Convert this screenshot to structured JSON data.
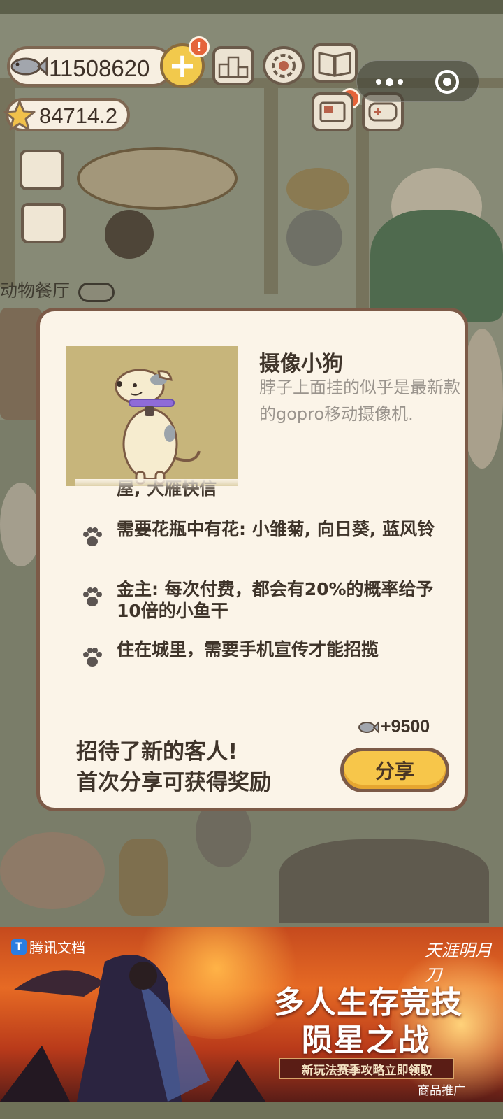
{
  "hud": {
    "fish_count": "11508620",
    "star_count": "84714.2",
    "plus_alert": "!",
    "book_alert": "!"
  },
  "scene": {
    "restaurant_label": "动物餐厅"
  },
  "dialog": {
    "guest_name": "摄像小狗",
    "guest_description": "脖子上面挂的似乎是最新款的gopro移动摄像机.",
    "requirements": [
      {
        "text": "屋, 大雁快信",
        "icon": "paw-icon"
      },
      {
        "text": "需要花瓶中有花: 小雏菊, 向日葵, 蓝风铃",
        "icon": "paw-icon"
      },
      {
        "text": "金主: 每次付费，都会有20%的概率给予10倍的小鱼干",
        "icon": "paw-icon"
      },
      {
        "text": "住在城里，需要手机宣传才能招揽",
        "icon": "paw-icon"
      }
    ],
    "message_line1": "招待了新的客人!",
    "message_line2": "首次分享可获得奖励",
    "reward": "+9500",
    "share_label": "分享"
  },
  "ad": {
    "brand": "腾讯文档",
    "game_logo": "天涯明月刀",
    "title_line1": "多人生存竞技",
    "title_line2": "陨星之战",
    "subtitle": "新玩法赛季攻略立即领取",
    "ad_mark": "商品推广"
  },
  "colors": {
    "dialog_bg": "#fbf4e8",
    "dialog_border": "#7c5a47",
    "share_button": "#f7c64a",
    "photo_bg": "#c7b57b"
  }
}
